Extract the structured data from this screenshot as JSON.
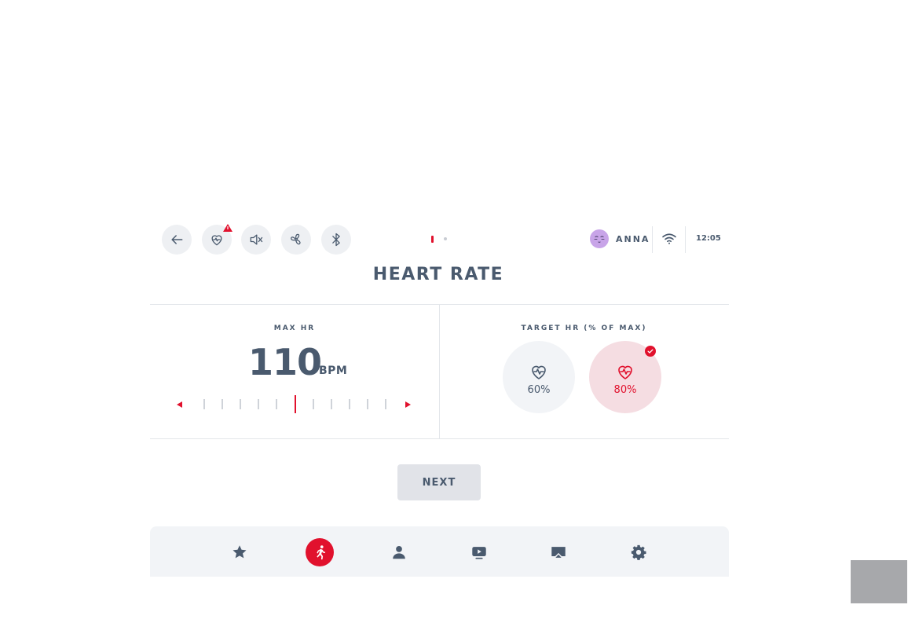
{
  "toolbar": {
    "buttons": [
      "back-arrow-icon",
      "heart-rate-icon",
      "mute-icon",
      "fan-icon",
      "bluetooth-icon"
    ],
    "alert_badge_icon": "warning-triangle-icon"
  },
  "pager": {
    "pages": 2,
    "current": 1
  },
  "user": {
    "name": "ANNA",
    "avatar_icon": "emoji-avatar-icon"
  },
  "status": {
    "wifi_icon": "wifi-icon",
    "time": "12:05"
  },
  "page_title": "HEART RATE",
  "max_hr": {
    "label": "MAX HR",
    "value": "110",
    "unit": "BPM",
    "slider_selected_index": 5,
    "slider_tick_count": 11
  },
  "target_hr": {
    "label": "TARGET HR (% OF MAX)",
    "options": [
      {
        "value": "60%",
        "selected": false,
        "icon": "heart-pulse-icon"
      },
      {
        "value": "80%",
        "selected": true,
        "icon": "heart-pulse-icon"
      }
    ]
  },
  "next_button": {
    "label": "NEXT"
  },
  "bottom_nav": {
    "items": [
      {
        "icon": "star-icon",
        "active": false
      },
      {
        "icon": "runner-icon",
        "active": true
      },
      {
        "icon": "person-icon",
        "active": false
      },
      {
        "icon": "video-play-icon",
        "active": false
      },
      {
        "icon": "airplay-icon",
        "active": false
      },
      {
        "icon": "gear-icon",
        "active": false
      }
    ]
  },
  "colors": {
    "accent": "#e1112d",
    "text": "#4a5a6e",
    "button_bg": "#eef0f3",
    "selected_option_bg": "#f5dde2"
  }
}
